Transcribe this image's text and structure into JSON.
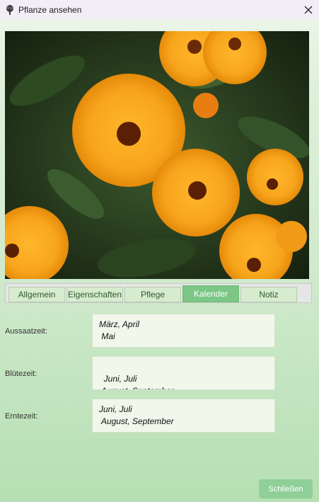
{
  "window": {
    "title": "Pflanze ansehen",
    "icon": "tree-icon",
    "close_icon": "close-icon"
  },
  "image": {
    "subject": "orange-marigold-flowers",
    "colors": {
      "petal": "#f7a51c",
      "center": "#5a2006",
      "foliage": "#2d4a22"
    }
  },
  "tabs": [
    {
      "label": "Allgemein",
      "active": false
    },
    {
      "label": "Eigenschaften",
      "active": false
    },
    {
      "label": "Pflege",
      "active": false
    },
    {
      "label": "Kalender",
      "active": true
    },
    {
      "label": "Notiz",
      "active": false
    }
  ],
  "fields": {
    "aussaat": {
      "label": "Aussaatzeit:",
      "value": "März, April\n Mai"
    },
    "bluete": {
      "label": "Blütezeit:",
      "value": "Juni, Juli\n August, September\n Oktober"
    },
    "ernte": {
      "label": "Erntezeit:",
      "value": "Juni, Juli\n August, September"
    }
  },
  "footer": {
    "close_label": "Schließen"
  },
  "colors": {
    "accent": "#7cc686",
    "button": "#8fcf98",
    "field_bg": "#f1f7ea"
  }
}
